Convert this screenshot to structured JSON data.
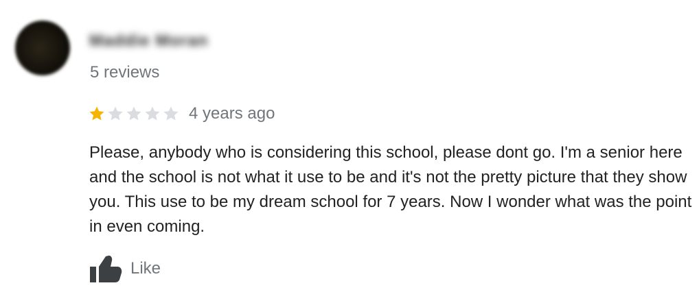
{
  "reviewer": {
    "name": "Maddie Moran",
    "review_count": "5 reviews"
  },
  "rating": {
    "value": 1,
    "max": 5,
    "filled_color": "#f4b400",
    "empty_color": "#dadce0"
  },
  "time_ago": "4 years ago",
  "review_text": "Please, anybody who is considering this school, please dont go. I'm a senior here and the school is not what it use to be and it's not the pretty picture that they show you. This use to be my dream school for 7 years. Now I wonder what was the point in even coming.",
  "actions": {
    "like_label": "Like",
    "like_icon": "thumbs-up-icon"
  }
}
